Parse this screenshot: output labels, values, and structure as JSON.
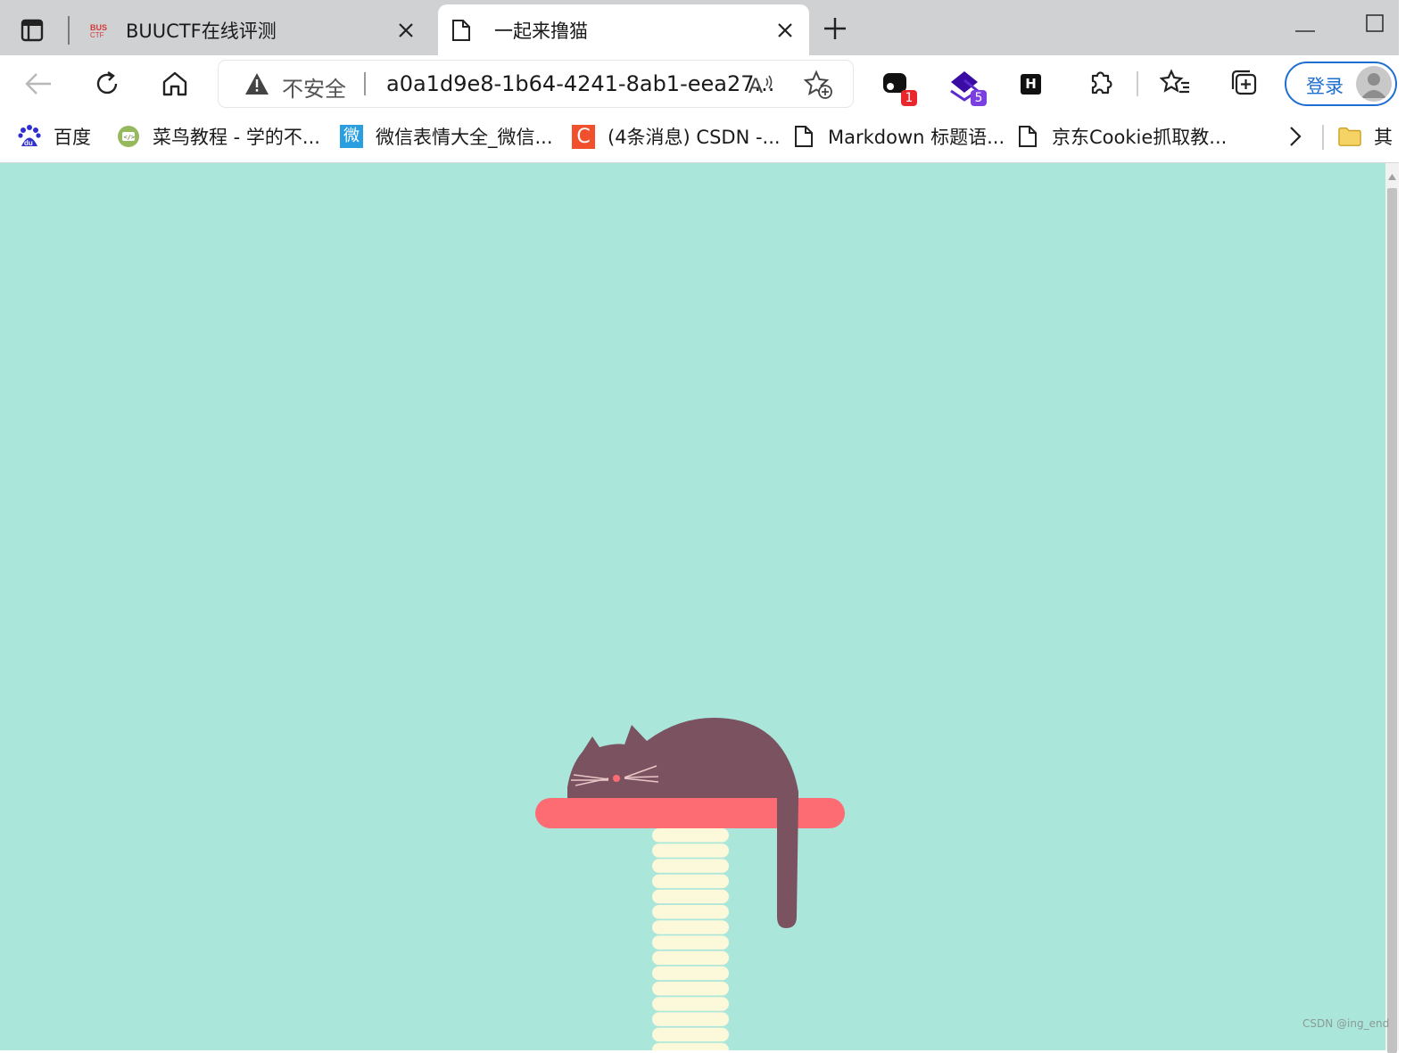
{
  "tabs": [
    {
      "title": "BUUCTF在线评测",
      "favicon": "buuctf-logo-icon",
      "active": false
    },
    {
      "title": "一起来撸猫",
      "favicon": "page-icon",
      "active": true
    }
  ],
  "toolbar": {
    "security_label": "不安全",
    "url": "a0a1d9e8-1b64-4241-8ab1-eea27...",
    "extension_badges": [
      "1",
      "5"
    ],
    "extension_h_label": "H",
    "login_label": "登录"
  },
  "bookmarks": [
    {
      "label": "百度",
      "icon": "baidu-icon"
    },
    {
      "label": "菜鸟教程 - 学的不...",
      "icon": "runoob-icon"
    },
    {
      "label": "微信表情大全_微信...",
      "icon": "weixin-icon"
    },
    {
      "label": "(4条消息) CSDN -...",
      "icon": "csdn-icon"
    },
    {
      "label": "Markdown 标题语...",
      "icon": "page-icon"
    },
    {
      "label": "京东Cookie抓取教...",
      "icon": "page-icon"
    }
  ],
  "bookmarks_folder_label": "其",
  "csdn_glyph": "C",
  "weixin_glyph": "微",
  "baidu_glyph": "du",
  "colors": {
    "page_background": "#abe6db",
    "cat": "#7a5260",
    "shelf": "#fc6c72",
    "post": "#fcf8da",
    "login_accent": "#1e6fd0"
  },
  "watermark": "CSDN @ing_end"
}
